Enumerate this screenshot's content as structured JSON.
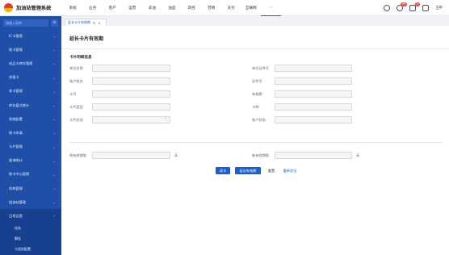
{
  "app": {
    "title": "加油站管理系统"
  },
  "nav": [
    "系统",
    "业务",
    "客户",
    "运营",
    "非油",
    "油品",
    "风控",
    "营销",
    "支付",
    "互联网",
    "···"
  ],
  "user": {
    "name": "王平",
    "badge1": "99",
    "badge2": "3"
  },
  "sidebar": {
    "search_placeholder": "请输入菜单",
    "items": [
      "IC卡管理",
      "账卡管理",
      "成品卡库存管理",
      "充值卡",
      "车卡管理",
      "库存盘点统计",
      "系统配置",
      "账卡申请",
      "卡片管理",
      "查询统计",
      "账卡中心管理",
      "机构管理",
      "加油站管理",
      "日常运营"
    ],
    "sub_items": [
      "挂失",
      "解挂",
      "卡类别配置"
    ]
  },
  "tab": {
    "label": "延长卡片有效期",
    "close": "×"
  },
  "page": {
    "title": "延长卡片有效期",
    "section": "卡片明细信息"
  },
  "form": {
    "unit_name": "单位名称",
    "unit_cert": "单位证件号",
    "account_name": "账户姓名",
    "cert_no": "证件号",
    "card_no": "卡号",
    "valid_period": "有效期",
    "card_type": "卡片类型",
    "card_id": "卡种",
    "card_status": "卡片状态",
    "account_status": "账户状态",
    "orig_valid": "原有效期限",
    "new_valid": "新有效期限",
    "day_unit": "天"
  },
  "buttons": {
    "read_card": "读卡",
    "extend": "延长有效期",
    "reset": "重置",
    "reload": "重新验证"
  }
}
